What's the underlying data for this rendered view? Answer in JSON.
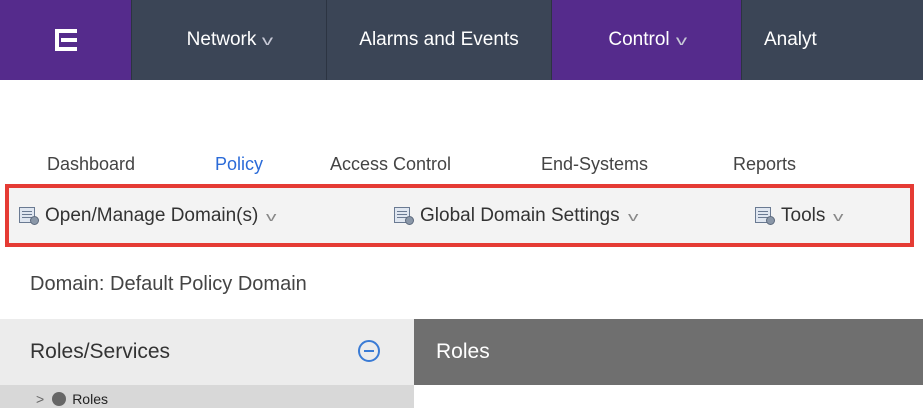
{
  "topnav": {
    "logo_icon": "extreme-logo-icon",
    "items": [
      {
        "label": "Network",
        "has_dropdown": true
      },
      {
        "label": "Alarms and Events",
        "has_dropdown": false
      },
      {
        "label": "Control",
        "has_dropdown": true,
        "active": true
      },
      {
        "label": "Analyt",
        "has_dropdown": false
      }
    ],
    "colors": {
      "background": "#3b4556",
      "accent": "#552b8c"
    }
  },
  "tabs": {
    "items": [
      "Dashboard",
      "Policy",
      "Access Control",
      "End-Systems",
      "Reports"
    ],
    "active": "Policy",
    "active_color": "#2b6bd8"
  },
  "toolbar": {
    "highlight_color": "#e53b34",
    "items": [
      {
        "label": "Open/Manage Domain(s)",
        "icon": "domain-settings-icon"
      },
      {
        "label": "Global Domain Settings",
        "icon": "domain-settings-icon"
      },
      {
        "label": "Tools",
        "icon": "domain-settings-icon"
      }
    ]
  },
  "domain": {
    "label": "Domain: Default Policy Domain"
  },
  "left_panel": {
    "title": "Roles/Services",
    "tree": [
      {
        "label": "Roles"
      }
    ]
  },
  "right_panel": {
    "title": "Roles"
  }
}
